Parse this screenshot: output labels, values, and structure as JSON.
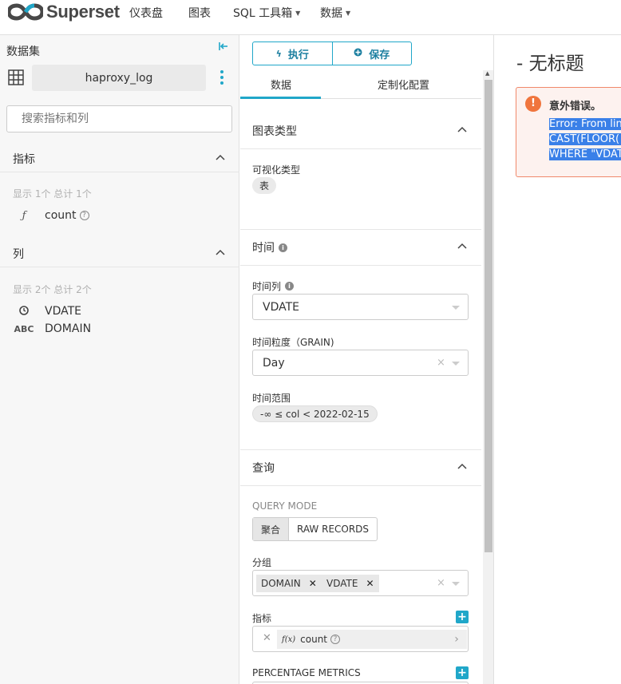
{
  "app": {
    "brand": "Superset",
    "nav": [
      {
        "label": "仪表盘",
        "has_caret": false
      },
      {
        "label": "图表",
        "has_caret": false
      },
      {
        "label": "SQL 工具箱",
        "has_caret": true
      },
      {
        "label": "数据",
        "has_caret": true
      }
    ]
  },
  "dataset_panel": {
    "title": "数据集",
    "dataset_name": "haproxy_log",
    "search_placeholder": "搜索指标和列",
    "metrics_section": {
      "label": "指标",
      "summary": "显示 1个 总计 1个",
      "items": [
        {
          "type_icon": "ƒ",
          "name": "count"
        }
      ]
    },
    "columns_section": {
      "label": "列",
      "summary": "显示 2个 总计 2个",
      "items": [
        {
          "type_icon": "clock-icon",
          "name": "VDATE"
        },
        {
          "type_icon": "ABC",
          "name": "DOMAIN"
        }
      ]
    }
  },
  "control_panel": {
    "run_label": "执行",
    "save_label": "保存",
    "tabs": [
      "数据",
      "定制化配置"
    ],
    "chart_type_section": {
      "label": "图表类型",
      "viz_type_label": "可视化类型",
      "viz_type_value": "表"
    },
    "time_section": {
      "label": "时间",
      "time_column_label": "时间列",
      "time_column_value": "VDATE",
      "time_grain_label": "时间粒度（GRAIN)",
      "time_grain_value": "Day",
      "time_range_label": "时间范围",
      "time_range_value": "-∞ ≤ col < 2022-02-15"
    },
    "query_section": {
      "label": "查询",
      "query_mode_label": "QUERY MODE",
      "query_modes": [
        "聚合",
        "RAW RECORDS"
      ],
      "active_mode": "聚合",
      "groupby_label": "分组",
      "groupby_values": [
        "DOMAIN",
        "VDATE"
      ],
      "metrics_label": "指标",
      "metric_value": "count",
      "metric_fx": "f(x)",
      "percentage_metrics_label": "PERCENTAGE METRICS"
    }
  },
  "chart_area": {
    "title": "- 无标题",
    "error": {
      "title": "意外错误。",
      "lines": [
        "Error: From lin",
        "CAST(FLOOR(",
        "WHERE \"VDAT"
      ]
    }
  },
  "colors": {
    "accent": "#20a7c9",
    "error_border": "#f0896b",
    "error_icon": "#f0753d",
    "selection": "#3a80e8"
  }
}
